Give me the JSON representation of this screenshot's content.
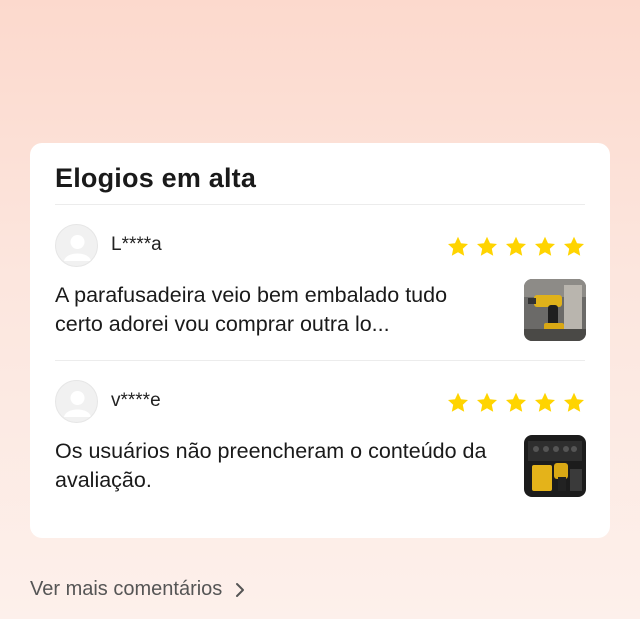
{
  "section": {
    "title": "Elogios em alta"
  },
  "reviews": [
    {
      "username": "L****a",
      "rating": 5,
      "text": "A parafusadeira veio bem embalado tudo certo adorei vou comprar outra lo..."
    },
    {
      "username": "v****e",
      "rating": 5,
      "text": "Os usuários não preencheram o conteúdo da avaliação."
    }
  ],
  "footer": {
    "more_label": "Ver mais comentários"
  },
  "colors": {
    "star": "#ffd400",
    "accent_bg": "#fcd9cd"
  },
  "icons": {
    "avatar": "user-avatar-icon",
    "star": "star-icon",
    "chevron": "chevron-right-icon"
  }
}
